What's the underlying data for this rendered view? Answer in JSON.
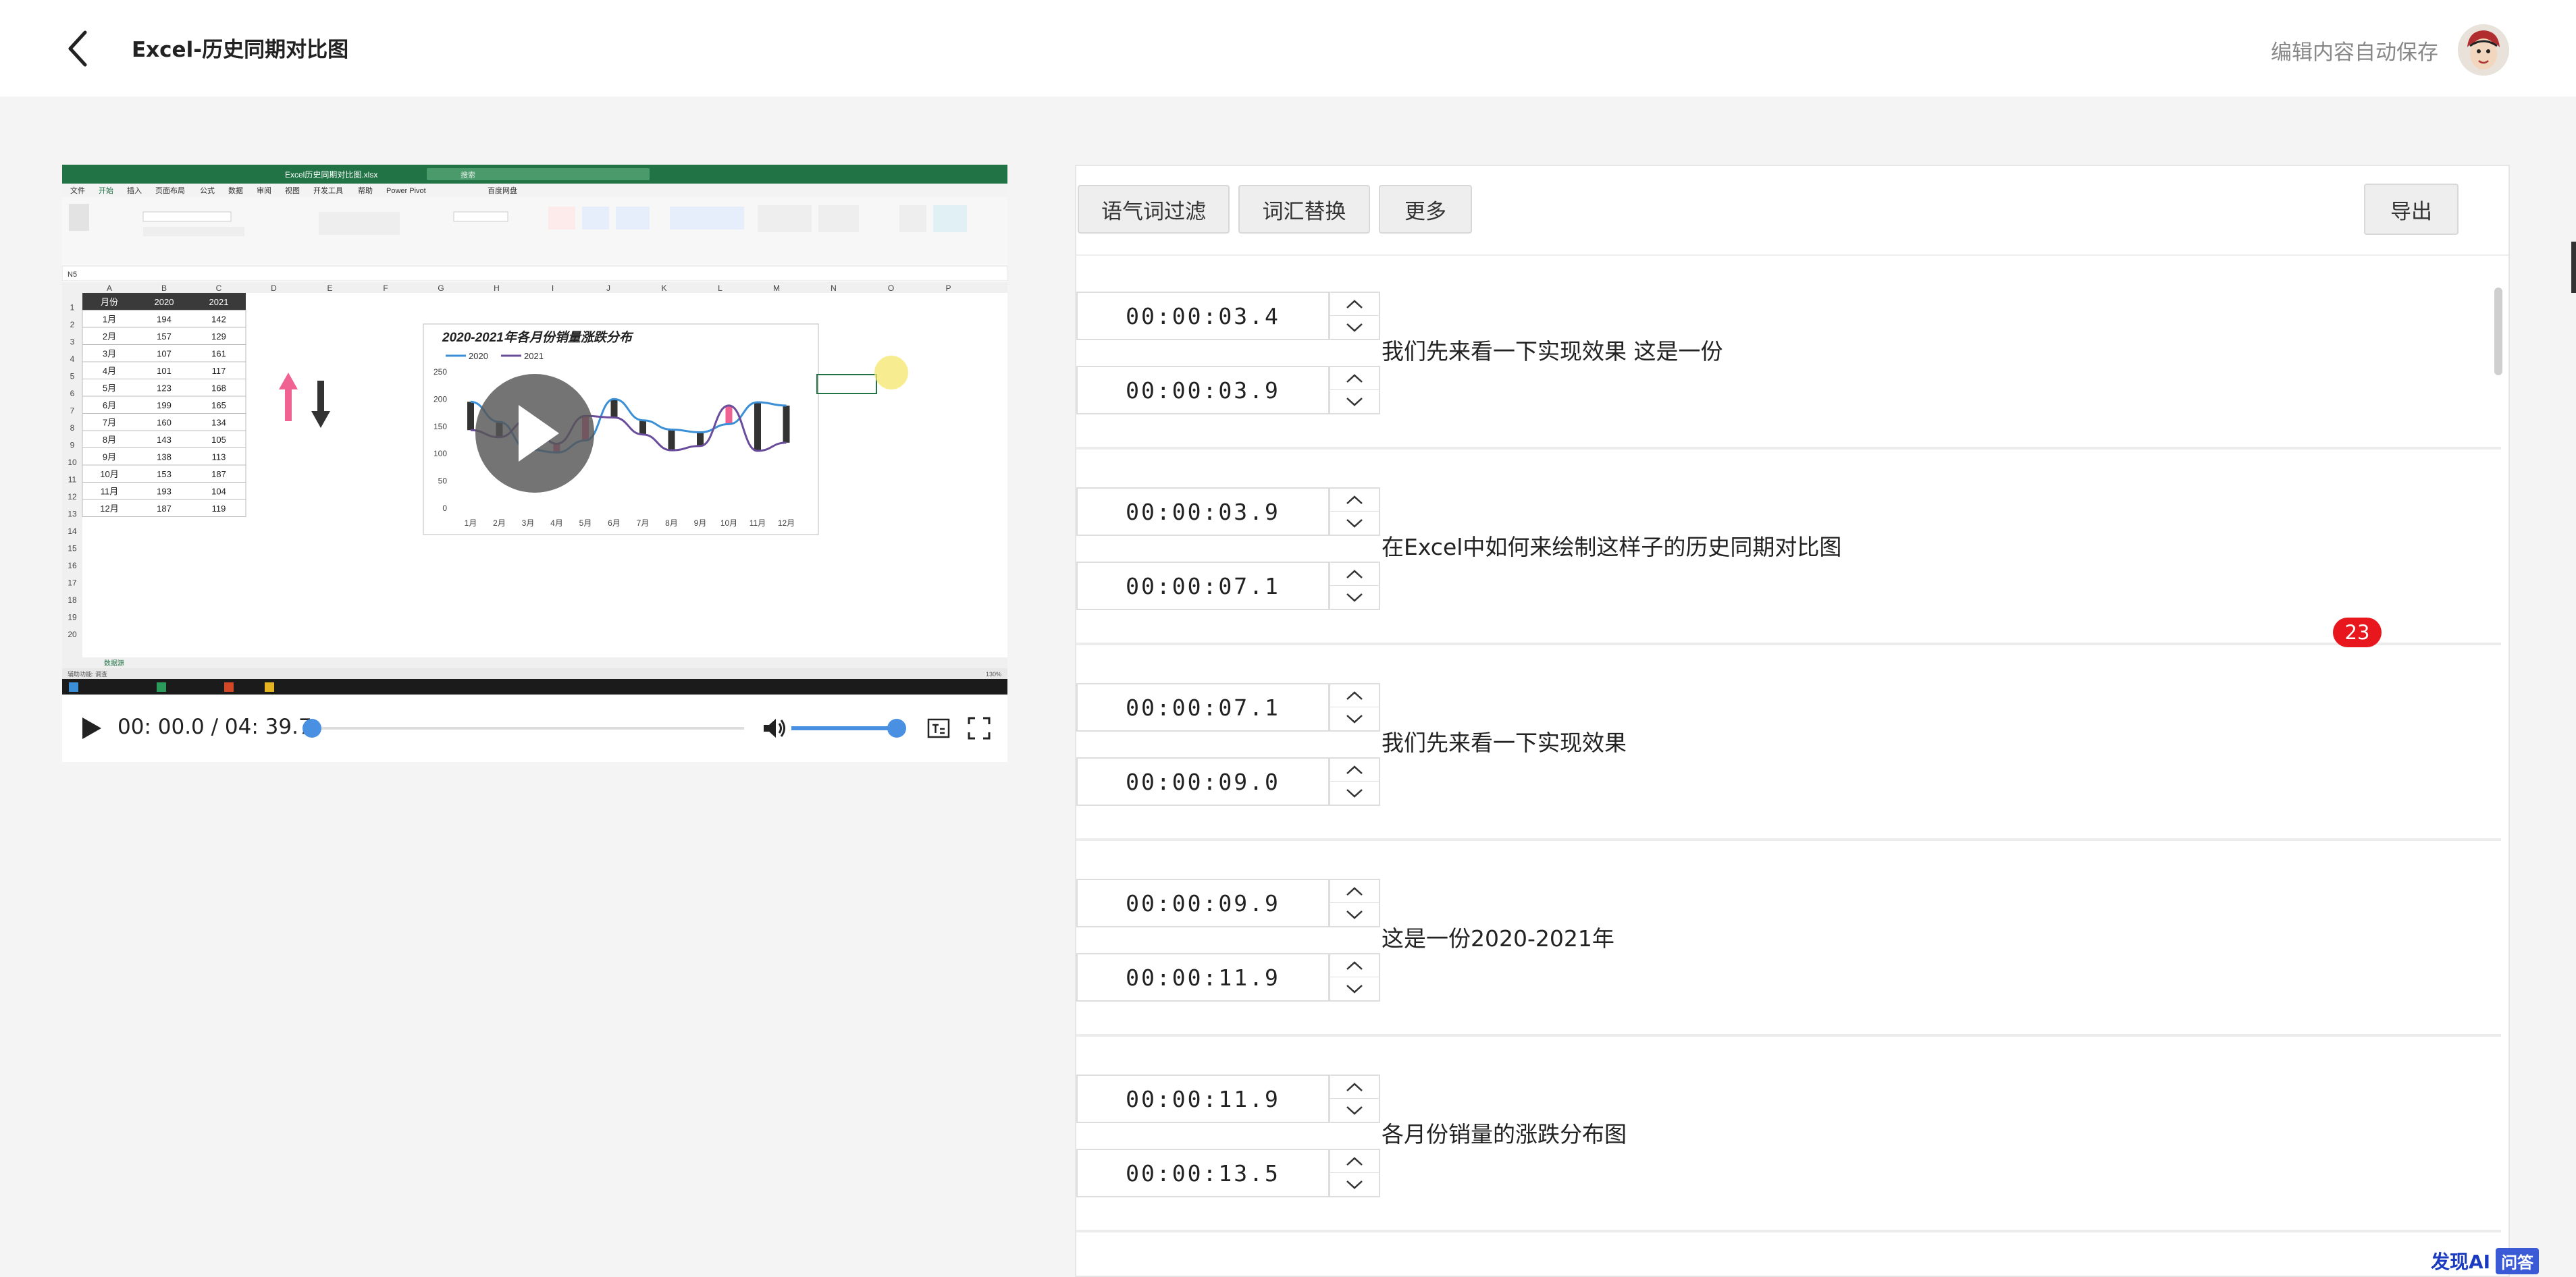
{
  "header": {
    "title": "Excel-历史同期对比图",
    "autosave": "编辑内容自动保存"
  },
  "player": {
    "time": "00: 00.0 / 04: 39.7",
    "progress": 0.0,
    "volume": 1.0,
    "excel": {
      "filename": "Excel历史同期对比图.xlsx",
      "search_placeholder": "搜索",
      "tabs": [
        "文件",
        "开始",
        "插入",
        "页面布局",
        "公式",
        "数据",
        "审阅",
        "视图",
        "开发工具",
        "帮助",
        "Power Pivot",
        "百度网盘"
      ],
      "cell_ref": "N5",
      "sheet_tab": "数据源",
      "status": "辅助功能: 调查",
      "zoom": "130%",
      "columns": [
        "A",
        "B",
        "C",
        "D",
        "E",
        "F",
        "G",
        "H",
        "I",
        "J",
        "K",
        "L",
        "M",
        "N",
        "O",
        "P"
      ],
      "headers": [
        "月份",
        "2020",
        "2021"
      ],
      "rows": [
        [
          "1月",
          "194",
          "142"
        ],
        [
          "2月",
          "157",
          "129"
        ],
        [
          "3月",
          "107",
          "161"
        ],
        [
          "4月",
          "101",
          "117"
        ],
        [
          "5月",
          "123",
          "168"
        ],
        [
          "6月",
          "199",
          "165"
        ],
        [
          "7月",
          "160",
          "134"
        ],
        [
          "8月",
          "143",
          "105"
        ],
        [
          "9月",
          "138",
          "113"
        ],
        [
          "10月",
          "153",
          "187"
        ],
        [
          "11月",
          "193",
          "104"
        ],
        [
          "12月",
          "187",
          "119"
        ]
      ]
    },
    "chart": {
      "title": "2020-2021年各月份销量涨跌分布",
      "legend": [
        "2020",
        "2021"
      ],
      "yticks": [
        "250",
        "200",
        "150",
        "100",
        "50",
        "0"
      ],
      "xticks": [
        "1月",
        "2月",
        "3月",
        "4月",
        "5月",
        "6月",
        "7月",
        "8月",
        "9月",
        "10月",
        "11月",
        "12月"
      ]
    }
  },
  "toolbar": {
    "filter": "语气词过滤",
    "replace": "词汇替换",
    "more": "更多",
    "export": "导出"
  },
  "segments": [
    {
      "start": "00:00:03.4",
      "end": "",
      "text": ""
    },
    {
      "start": "00:00:03.4",
      "end": "00:00:03.9",
      "text": "我们先来看一下实现效果 这是一份"
    },
    {
      "start": "00:00:03.9",
      "end": "00:00:07.1",
      "text": "在Excel中如何来绘制这样子的历史同期对比图"
    },
    {
      "start": "00:00:07.1",
      "end": "00:00:09.0",
      "text": " 我们先来看一下实现效果"
    },
    {
      "start": "00:00:09.9",
      "end": "00:00:11.9",
      "text": "这是一份2020-2021年"
    },
    {
      "start": "00:00:11.9",
      "end": "00:00:13.5",
      "text": "各月份销量的涨跌分布图"
    }
  ],
  "badge": "23",
  "logo": {
    "text": "发现AI",
    "qa": "问答"
  }
}
